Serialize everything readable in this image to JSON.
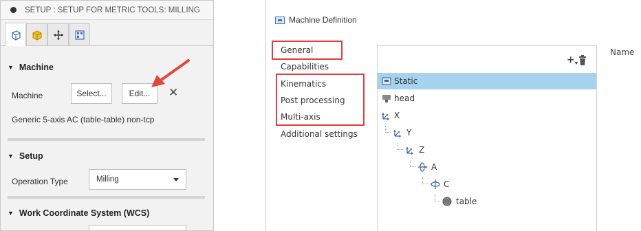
{
  "setup_panel": {
    "header_title": "SETUP : SETUP FOR METRIC TOOLS: MILLING",
    "tabs": [
      {
        "icon": "setup-cube-icon",
        "active": true
      },
      {
        "icon": "stock-box-icon",
        "active": false
      },
      {
        "icon": "move-icon",
        "active": false
      },
      {
        "icon": "post-process-icon",
        "active": false
      }
    ],
    "machine": {
      "section_title": "Machine",
      "field_label": "Machine",
      "select_label": "Select...",
      "edit_label": "Edit...",
      "clear_label": "✕",
      "machine_name": "Generic 5-axis AC (table-table) non-tcp"
    },
    "setup": {
      "section_title": "Setup",
      "operation_type_label": "Operation Type",
      "operation_type_value": "Milling"
    },
    "wcs": {
      "section_title": "Work Coordinate System (WCS)"
    }
  },
  "machine_definition": {
    "title": "Machine Definition",
    "nav": [
      {
        "label": "General",
        "highlighted": true
      },
      {
        "label": "Capabilities",
        "highlighted": false
      },
      {
        "label": "Kinematics",
        "highlighted": true
      },
      {
        "label": "Post processing",
        "highlighted": true
      },
      {
        "label": "Multi-axis",
        "highlighted": true
      },
      {
        "label": "Additional settings",
        "highlighted": false
      }
    ],
    "tree": [
      {
        "label": "Static",
        "icon": "static-icon",
        "selected": true
      },
      {
        "label": "head",
        "icon": "head-icon",
        "selected": false
      },
      {
        "label": "X",
        "icon": "linear-axis-icon",
        "selected": false
      },
      {
        "label": "Y",
        "icon": "linear-axis-icon",
        "selected": false
      },
      {
        "label": "Z",
        "icon": "linear-axis-icon",
        "selected": false
      },
      {
        "label": "A",
        "icon": "rotary-axis-icon",
        "selected": false
      },
      {
        "label": "C",
        "icon": "rotary-axis-icon",
        "selected": false
      },
      {
        "label": "table",
        "icon": "table-icon",
        "selected": false
      }
    ],
    "name_column": "Name"
  },
  "colors": {
    "highlight_red": "#e23c3c",
    "selection_blue": "#a7d2ee",
    "arrow_red": "#e4463b"
  }
}
